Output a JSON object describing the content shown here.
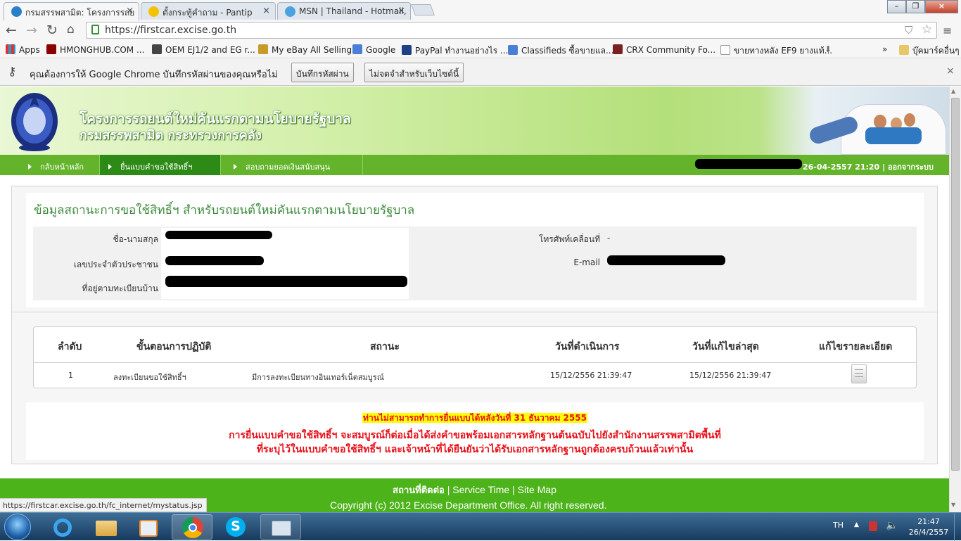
{
  "browser": {
    "tabs": [
      {
        "title": "กรมสรรพสามิต: โครงการรถย"
      },
      {
        "title": "ตั้งกระทู้คำถาม - Pantip"
      },
      {
        "title": "MSN | Thailand - Hotmail,"
      }
    ],
    "url": "https://firstcar.excise.go.th",
    "bookmarks": [
      "Apps",
      "HMONGHUB.COM ...",
      "OEM EJ1/2 and EG r...",
      "My eBay All Selling",
      "Google",
      "PayPal ทำงานอย่างไร ...",
      "Classifieds ซื้อขายแล...",
      "CRX Community Fo...",
      "ขายทางหลัง EF9 ยางแท้...",
      "บุ๊คมาร์คอื่นๆ"
    ],
    "bookmarks_more": "»",
    "infobar": {
      "text": "คุณต้องการให้ Google Chrome บันทึกรหัสผ่านของคุณหรือไม่",
      "save_button": "บันทึกรหัสผ่าน",
      "never_button": "ไม่จดจำสำหรับเว็บไซต์นี้",
      "close": "×"
    },
    "status_url": "https://firstcar.excise.go.th/fc_internet/mystatus.jsp"
  },
  "site": {
    "header_line1": "โครงการรถยนต์ใหม่คันแรกตามนโยบายรัฐบาล",
    "header_line2": "กรมสรรพสามิต กระทรวงการคลัง",
    "nav": [
      "กลับหน้าหลัก",
      "ยื่นแบบคำขอใช้สิทธิ์ฯ",
      "สอบถามยอดเงินสนับสนุน"
    ],
    "nav_right": {
      "datetime": "26-04-2557 21:20",
      "sep": "|",
      "logout": "ออกจากระบบ"
    }
  },
  "main": {
    "title": "ข้อมูลสถานะการขอใช้สิทธิ์ฯ สำหรับรถยนต์ใหม่คันแรกตามนโยบายรัฐบาล",
    "fields": {
      "name_label": "ชื่อ-นามสกุล",
      "id_label": "เลขประจำตัวประชาชน",
      "address_label": "ที่อยู่ตามทะเบียนบ้าน",
      "mobile_label": "โทรศัพท์เคลื่อนที่",
      "mobile_value": "-",
      "email_label": "E-mail"
    },
    "table": {
      "headers": [
        "ลำดับ",
        "ขั้นตอนการปฏิบัติ",
        "สถานะ",
        "วันที่ดำเนินการ",
        "วันที่แก้ไขล่าสุด",
        "แก้ไขรายละเอียด"
      ],
      "rows": [
        [
          "1",
          "ลงทะเบียนขอใช้สิทธิ์ฯ",
          "มีการลงทะเบียนทางอินเทอร์เน็ตสมบูรณ์",
          "15/12/2556 21:39:47",
          "15/12/2556 21:39:47"
        ]
      ]
    },
    "notice_highlight": "ท่านไม่สามารถทำการยื่นแบบได้หลังวันที่ 31 ธันวาคม 2555",
    "notice_line1": "การยื่นแบบคำขอใช้สิทธิ์ฯ จะสมบูรณ์ก็ต่อเมื่อได้ส่งคำขอพร้อมเอกสารหลักฐานต้นฉบับไปยังสำนักงานสรรพสามิตพื้นที่",
    "notice_line2": "ที่ระบุไว้ในแบบคำขอใช้สิทธิ์ฯ และเจ้าหน้าที่ได้ยืนยันว่าได้รับเอกสารหลักฐานถูกต้องครบถ้วนแล้วเท่านั้น"
  },
  "footer": {
    "links": [
      "สถานที่ติดต่อ",
      "Service Time",
      "Site Map"
    ],
    "sep": "|",
    "copyright": "Copyright (c) 2012 Excise Department Office. All right reserved."
  },
  "taskbar": {
    "lang": "TH",
    "time": "21:47",
    "date": "26/4/2557"
  },
  "colors": {
    "nav_green": "#63b42a",
    "nav_active": "#2d8a16",
    "footer_green": "#4db31b",
    "title_green": "#3d8b3d",
    "notice_red": "#e8101a",
    "highlight_yellow": "#ffff00"
  },
  "icons": [
    "close-icon",
    "back-icon",
    "forward-icon",
    "reload-icon",
    "home-icon",
    "lock-icon",
    "star-icon",
    "menu-icon",
    "key-icon",
    "edit-document-icon",
    "start-icon",
    "ie-icon",
    "explorer-icon",
    "media-icon",
    "chrome-icon",
    "skype-icon",
    "app-icon"
  ]
}
